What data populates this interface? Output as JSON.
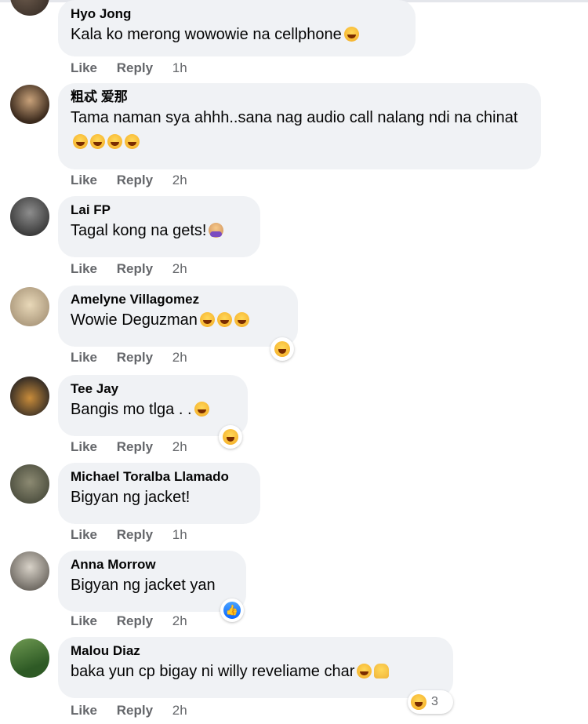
{
  "actions": {
    "like": "Like",
    "reply": "Reply"
  },
  "comments": [
    {
      "name": "Hyo Jong",
      "text": "Kala ko merong wowowie na cellphone",
      "emoji": [
        "laughing"
      ],
      "time": "1h"
    },
    {
      "name": "粗忒 爱那",
      "text": "Tama naman sya ahhh..sana nag audio call nalang ndi na chinat",
      "emoji": [
        "rofl",
        "rofl",
        "rofl",
        "rofl"
      ],
      "time": "2h"
    },
    {
      "name": "Lai FP",
      "text": "Tagal kong na gets!",
      "emoji": [
        "facepalm"
      ],
      "time": "2h"
    },
    {
      "name": "Amelyne Villagomez",
      "text": "Wowie Deguzman",
      "emoji": [
        "rofl",
        "rofl",
        "rofl"
      ],
      "time": "2h",
      "reaction": "haha"
    },
    {
      "name": "Tee Jay",
      "text": "Bangis mo tlga . .",
      "emoji": [
        "rofl"
      ],
      "time": "2h",
      "reaction": "haha"
    },
    {
      "name": "Michael Toralba Llamado",
      "text": "Bigyan ng jacket!",
      "time": "1h"
    },
    {
      "name": "Anna Morrow",
      "text": "Bigyan ng jacket yan",
      "time": "2h",
      "reaction": "like"
    },
    {
      "name": "Malou Diaz",
      "text": "baka yun cp bigay ni willy reveliame char",
      "emoji": [
        "laughing",
        "victory-hand"
      ],
      "time": "2h",
      "reaction": "haha",
      "reaction_count": "3"
    }
  ],
  "colors": {
    "bubble": "#f0f2f5",
    "meta": "#65676b",
    "like_blue": "#0866ff"
  }
}
